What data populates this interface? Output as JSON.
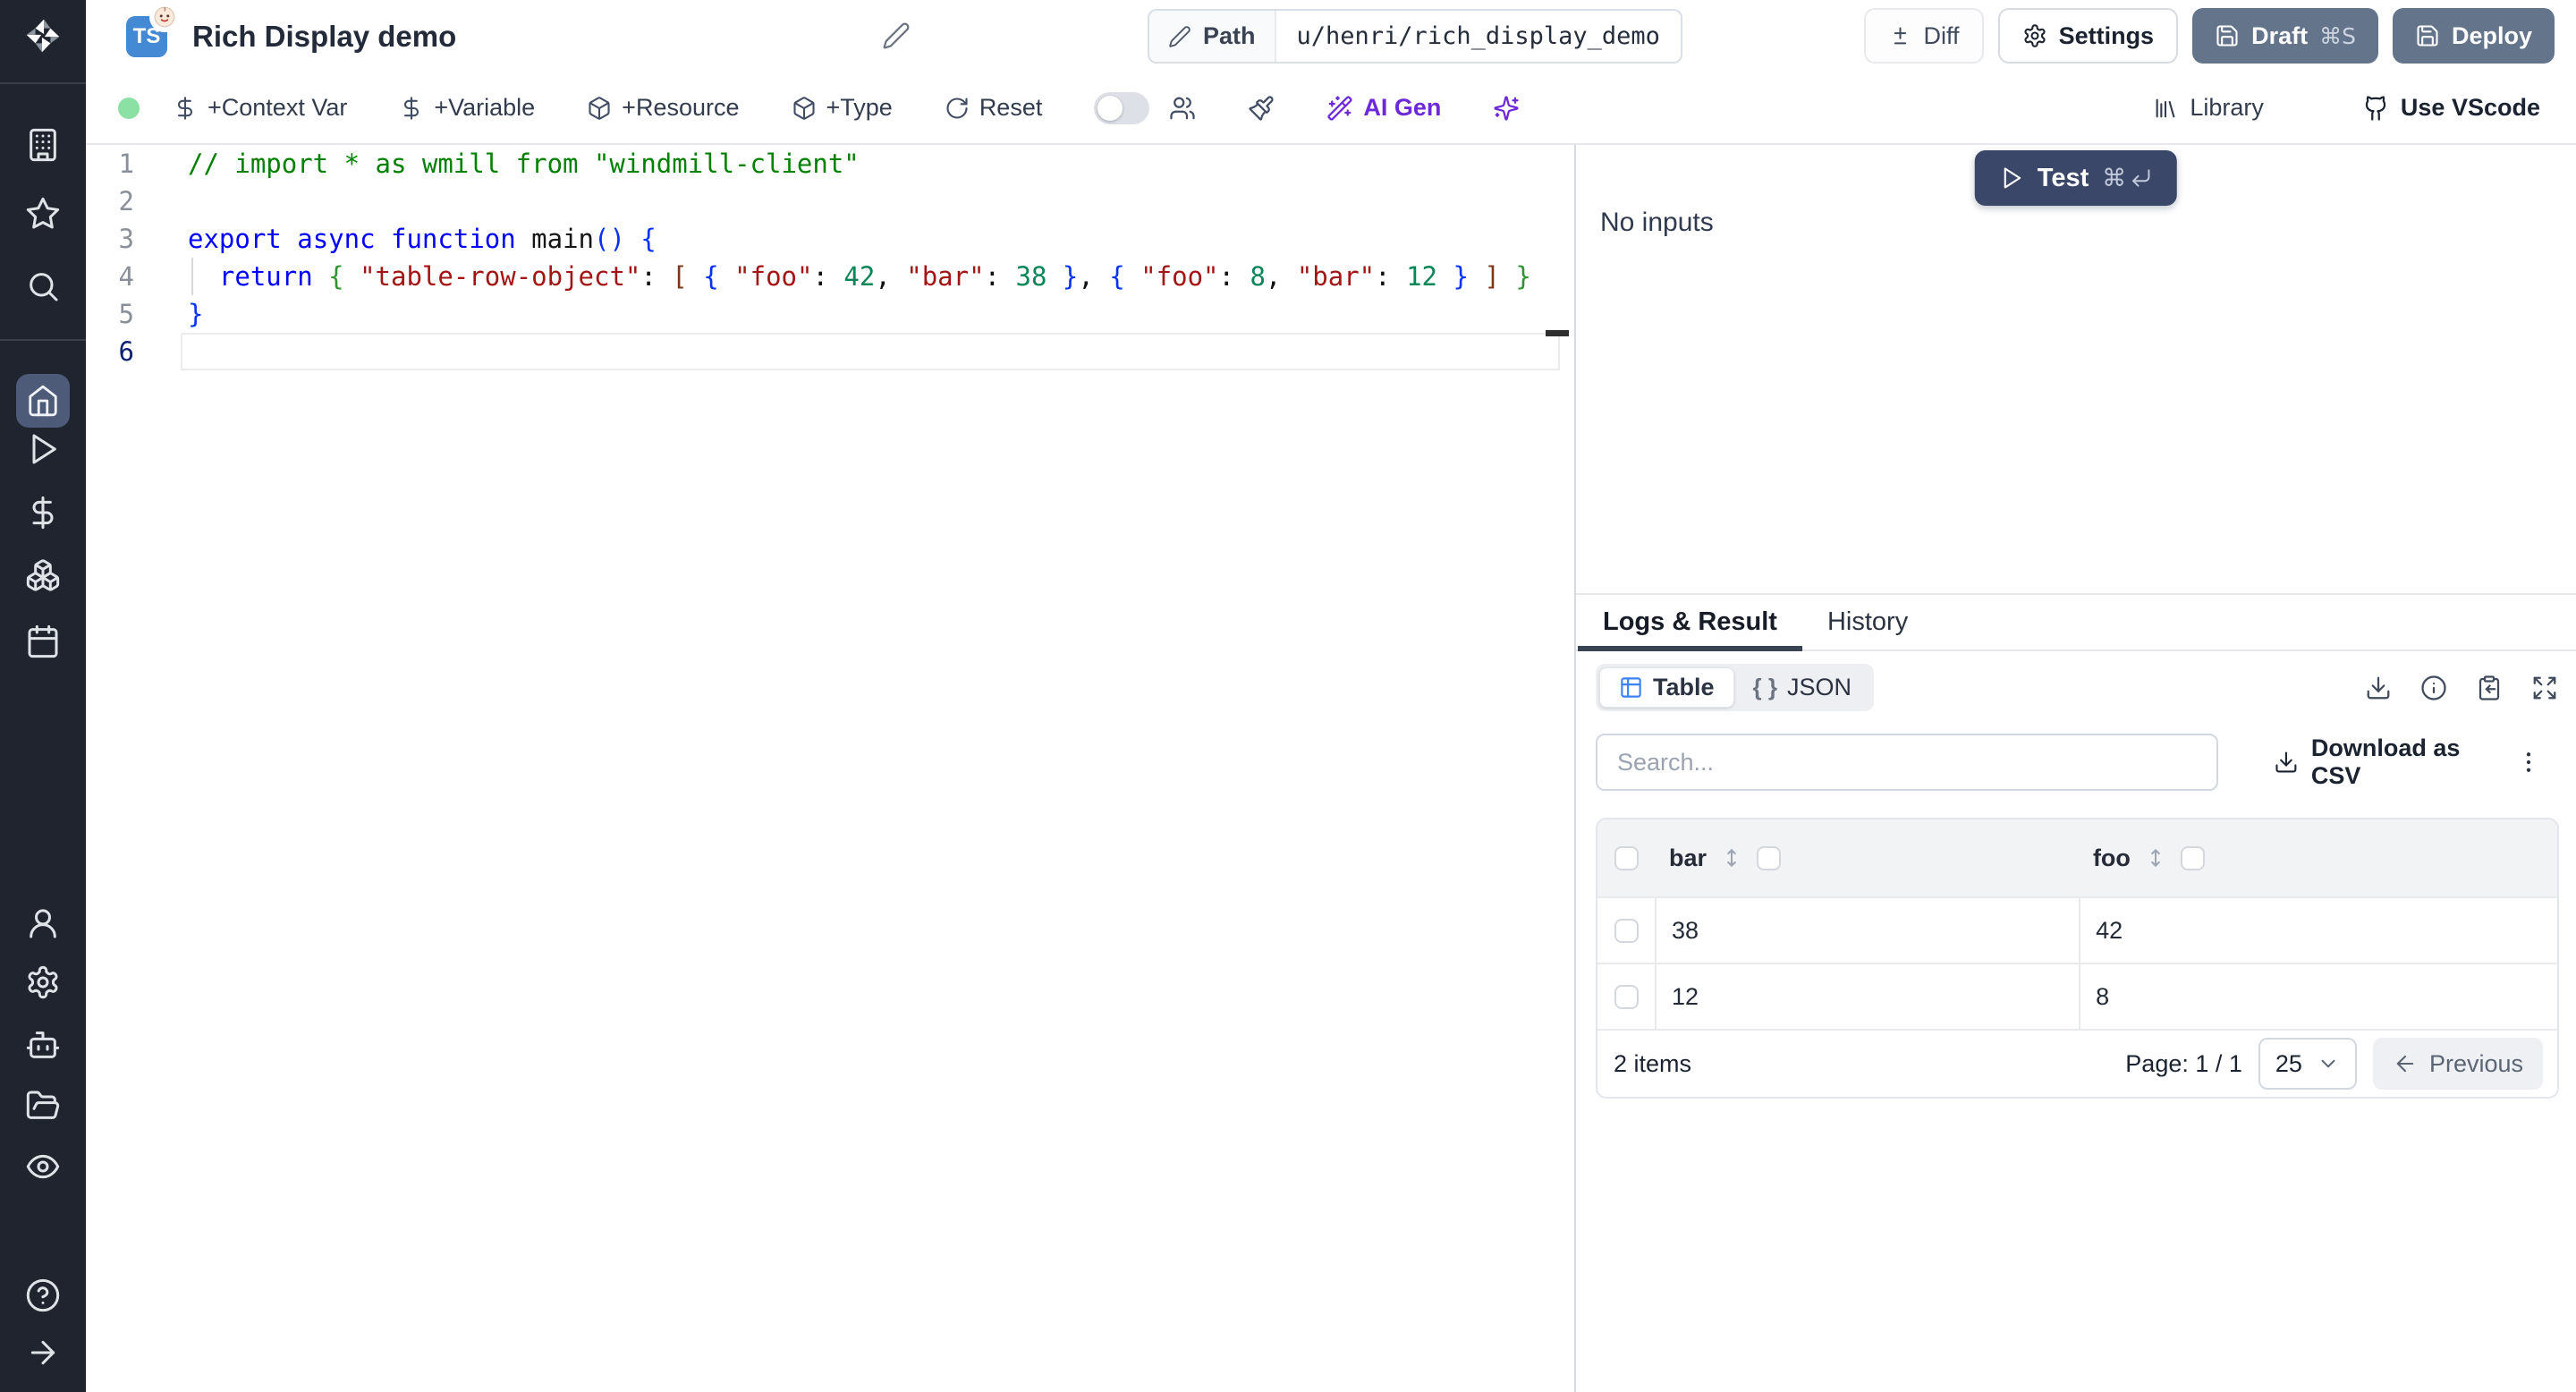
{
  "header": {
    "badge": "TS",
    "title": "Rich Display demo",
    "path_label": "Path",
    "path_value": "u/henri/rich_display_demo",
    "diff_label": "Diff",
    "settings_label": "Settings",
    "draft_label": "Draft",
    "draft_shortcut": "⌘S",
    "deploy_label": "Deploy"
  },
  "toolbar": {
    "context_var": "+Context Var",
    "variable": "+Variable",
    "resource": "+Resource",
    "type": "+Type",
    "reset": "Reset",
    "ai_gen": "AI Gen",
    "library": "Library",
    "use_vscode": "Use VScode"
  },
  "editor": {
    "lines": [
      {
        "number": 1,
        "tokens": [
          {
            "c": "cmt",
            "t": "// import * as wmill from \"windmill-client\""
          }
        ]
      },
      {
        "number": 2,
        "tokens": []
      },
      {
        "number": 3,
        "tokens": [
          {
            "c": "kw",
            "t": "export"
          },
          {
            "c": "pl",
            "t": " "
          },
          {
            "c": "kw",
            "t": "async"
          },
          {
            "c": "pl",
            "t": " "
          },
          {
            "c": "kw",
            "t": "function"
          },
          {
            "c": "pl",
            "t": " "
          },
          {
            "c": "fn",
            "t": "main"
          },
          {
            "c": "b0",
            "t": "()"
          },
          {
            "c": "pl",
            "t": " "
          },
          {
            "c": "b0",
            "t": "{"
          }
        ]
      },
      {
        "number": 4,
        "guide": true,
        "tokens": [
          {
            "c": "pl",
            "t": "  "
          },
          {
            "c": "kw",
            "t": "return"
          },
          {
            "c": "pl",
            "t": " "
          },
          {
            "c": "b1",
            "t": "{"
          },
          {
            "c": "pl",
            "t": " "
          },
          {
            "c": "str",
            "t": "\"table-row-object\""
          },
          {
            "c": "pl",
            "t": ": "
          },
          {
            "c": "b2",
            "t": "["
          },
          {
            "c": "pl",
            "t": " "
          },
          {
            "c": "b0",
            "t": "{"
          },
          {
            "c": "pl",
            "t": " "
          },
          {
            "c": "str",
            "t": "\"foo\""
          },
          {
            "c": "pl",
            "t": ": "
          },
          {
            "c": "num",
            "t": "42"
          },
          {
            "c": "pl",
            "t": ", "
          },
          {
            "c": "str",
            "t": "\"bar\""
          },
          {
            "c": "pl",
            "t": ": "
          },
          {
            "c": "num",
            "t": "38"
          },
          {
            "c": "pl",
            "t": " "
          },
          {
            "c": "b0",
            "t": "}"
          },
          {
            "c": "pl",
            "t": ", "
          },
          {
            "c": "b0",
            "t": "{"
          },
          {
            "c": "pl",
            "t": " "
          },
          {
            "c": "str",
            "t": "\"foo\""
          },
          {
            "c": "pl",
            "t": ": "
          },
          {
            "c": "num",
            "t": "8"
          },
          {
            "c": "pl",
            "t": ", "
          },
          {
            "c": "str",
            "t": "\"bar\""
          },
          {
            "c": "pl",
            "t": ": "
          },
          {
            "c": "num",
            "t": "12"
          },
          {
            "c": "pl",
            "t": " "
          },
          {
            "c": "b0",
            "t": "}"
          },
          {
            "c": "pl",
            "t": " "
          },
          {
            "c": "b2",
            "t": "]"
          },
          {
            "c": "pl",
            "t": " "
          },
          {
            "c": "b1",
            "t": "}"
          }
        ]
      },
      {
        "number": 5,
        "tokens": [
          {
            "c": "b0",
            "t": "}"
          }
        ]
      },
      {
        "number": 6,
        "active": true,
        "current": true,
        "tokens": []
      }
    ]
  },
  "run_panel": {
    "test_label": "Test",
    "test_cmd_glyph": "⌘",
    "no_inputs": "No inputs"
  },
  "result_panel": {
    "tabs": [
      {
        "label": "Logs & Result",
        "active": true
      },
      {
        "label": "History",
        "active": false
      }
    ],
    "view_toggle": {
      "table": "Table",
      "json": "JSON",
      "json_glyph": "{ }"
    },
    "search_placeholder": "Search...",
    "download_csv": "Download as CSV",
    "table": {
      "columns": [
        "bar",
        "foo"
      ],
      "rows": [
        {
          "bar": "38",
          "foo": "42"
        },
        {
          "bar": "12",
          "foo": "8"
        }
      ]
    },
    "footer": {
      "count": "2 items",
      "page": "Page: 1 / 1",
      "page_size": "25",
      "previous": "Previous"
    }
  },
  "icons": {
    "sidebar": [
      "windmill-logo",
      "building",
      "star",
      "search",
      "home",
      "play",
      "dollar",
      "boxes",
      "calendar",
      "user",
      "settings",
      "robot",
      "folder-open",
      "eye",
      "help-circle",
      "arrow-right"
    ],
    "kebab": "more-vertical",
    "test_shortcut": "command + return"
  },
  "colors": {
    "sidebar_bg": "#20242e",
    "sidebar_active": "#4d5a78",
    "slate_button": "#64748b",
    "test_button": "#3b4768",
    "accent_purple": "#6d28d9",
    "ts_badge_blue": "#4489d3",
    "status_green": "#8be0a4",
    "table_icon_blue": "#3b82f6",
    "tab_underline": "#3a4353"
  }
}
